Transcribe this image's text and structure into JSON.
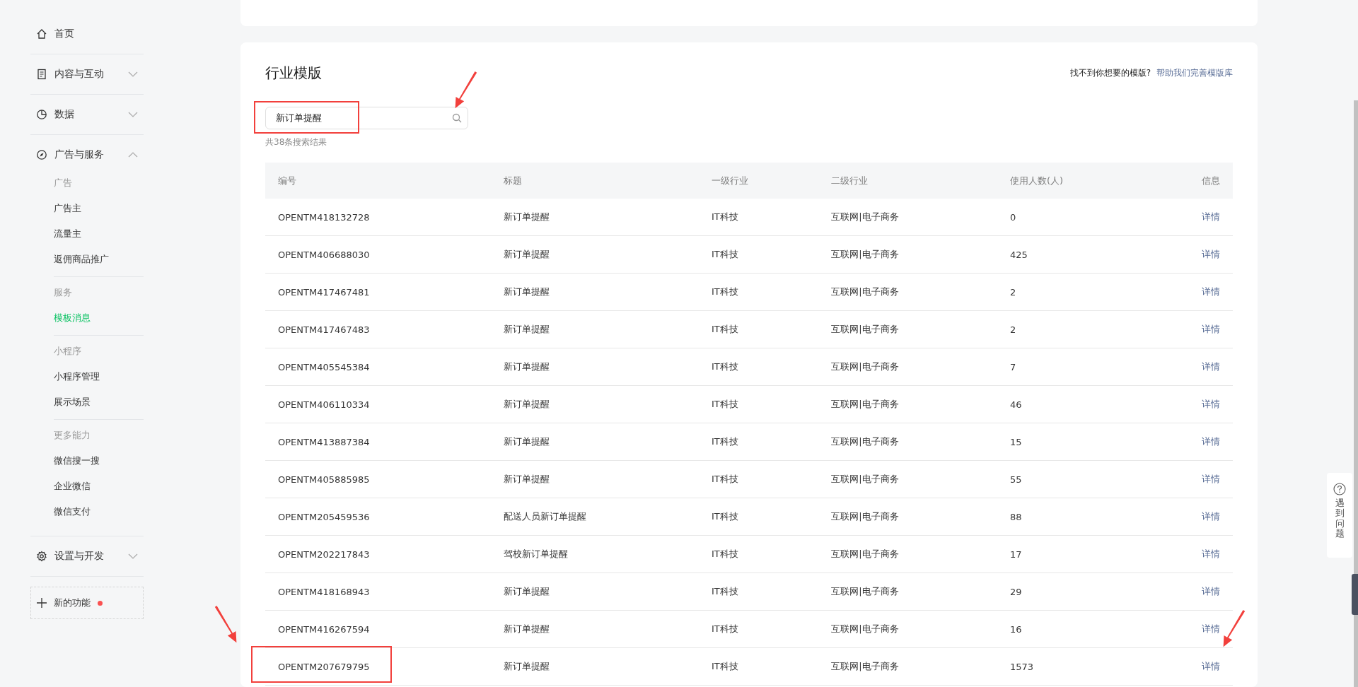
{
  "sidebar": {
    "sections": [
      {
        "label": "首页"
      },
      {
        "label": "内容与互动",
        "expanded": false
      },
      {
        "label": "数据",
        "expanded": false
      },
      {
        "label": "广告与服务",
        "expanded": true,
        "groups": [
          {
            "heading": "广告",
            "items": [
              {
                "label": "广告主",
                "selected": false
              },
              {
                "label": "流量主",
                "selected": false
              },
              {
                "label": "返佣商品推广",
                "selected": false
              }
            ]
          },
          {
            "heading": "服务",
            "items": [
              {
                "label": "模板消息",
                "selected": true
              }
            ]
          },
          {
            "heading": "小程序",
            "items": [
              {
                "label": "小程序管理",
                "selected": false
              },
              {
                "label": "展示场景",
                "selected": false
              }
            ]
          },
          {
            "heading": "更多能力",
            "items": [
              {
                "label": "微信搜一搜",
                "selected": false
              },
              {
                "label": "企业微信",
                "selected": false
              },
              {
                "label": "微信支付",
                "selected": false
              }
            ]
          }
        ]
      },
      {
        "label": "设置与开发",
        "expanded": false
      }
    ],
    "new_feature": {
      "label": "新的功能",
      "dot": true
    }
  },
  "panel": {
    "title": "行业模版",
    "help_text": "找不到你想要的模版?",
    "help_link": "帮助我们完善模版库",
    "search": {
      "value": "新订单提醒",
      "highlighted": true
    },
    "result_count": "共38条搜索结果",
    "table": {
      "columns": [
        "编号",
        "标题",
        "一级行业",
        "二级行业",
        "使用人数(人)",
        "信息"
      ],
      "rows": [
        {
          "cells": [
            "OPENTM418132728",
            "新订单提醒",
            "IT科技",
            "互联网|电子商务",
            "0",
            "详情"
          ],
          "highlighted": false
        },
        {
          "cells": [
            "OPENTM406688030",
            "新订单提醒",
            "IT科技",
            "互联网|电子商务",
            "425",
            "详情"
          ],
          "highlighted": false
        },
        {
          "cells": [
            "OPENTM417467481",
            "新订单提醒",
            "IT科技",
            "互联网|电子商务",
            "2",
            "详情"
          ],
          "highlighted": false
        },
        {
          "cells": [
            "OPENTM417467483",
            "新订单提醒",
            "IT科技",
            "互联网|电子商务",
            "2",
            "详情"
          ],
          "highlighted": false
        },
        {
          "cells": [
            "OPENTM405545384",
            "新订单提醒",
            "IT科技",
            "互联网|电子商务",
            "7",
            "详情"
          ],
          "highlighted": false
        },
        {
          "cells": [
            "OPENTM406110334",
            "新订单提醒",
            "IT科技",
            "互联网|电子商务",
            "46",
            "详情"
          ],
          "highlighted": false
        },
        {
          "cells": [
            "OPENTM413887384",
            "新订单提醒",
            "IT科技",
            "互联网|电子商务",
            "15",
            "详情"
          ],
          "highlighted": false
        },
        {
          "cells": [
            "OPENTM405885985",
            "新订单提醒",
            "IT科技",
            "互联网|电子商务",
            "55",
            "详情"
          ],
          "highlighted": false
        },
        {
          "cells": [
            "OPENTM205459536",
            "配送人员新订单提醒",
            "IT科技",
            "互联网|电子商务",
            "88",
            "详情"
          ],
          "highlighted": false
        },
        {
          "cells": [
            "OPENTM202217843",
            "驾校新订单提醒",
            "IT科技",
            "互联网|电子商务",
            "17",
            "详情"
          ],
          "highlighted": false
        },
        {
          "cells": [
            "OPENTM418168943",
            "新订单提醒",
            "IT科技",
            "互联网|电子商务",
            "29",
            "详情"
          ],
          "highlighted": false
        },
        {
          "cells": [
            "OPENTM416267594",
            "新订单提醒",
            "IT科技",
            "互联网|电子商务",
            "16",
            "详情"
          ],
          "highlighted": false
        },
        {
          "cells": [
            "OPENTM207679795",
            "新订单提醒",
            "IT科技",
            "互联网|电子商务",
            "1573",
            "详情"
          ],
          "highlighted": true
        }
      ]
    }
  },
  "help_widget": {
    "label": "遇到问题"
  }
}
